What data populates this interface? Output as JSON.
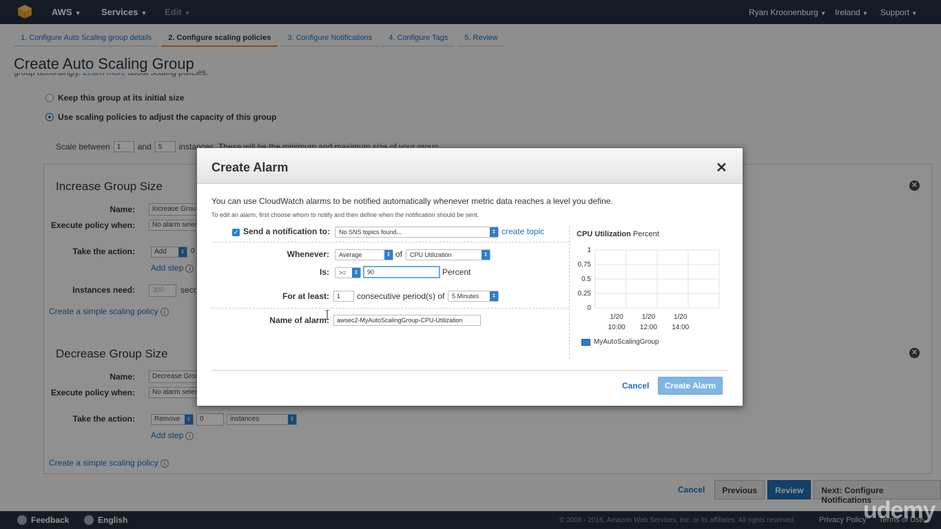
{
  "topbar": {
    "brand": "AWS",
    "services": "Services",
    "edit": "Edit",
    "user": "Ryan Kroonenburg",
    "region": "Ireland",
    "support": "Support"
  },
  "wizard_steps": [
    "1. Configure Auto Scaling group details",
    "2. Configure scaling policies",
    "3. Configure Notifications",
    "4. Configure Tags",
    "5. Review"
  ],
  "page": {
    "title": "Create Auto Scaling Group",
    "sub_prefix": "group accordingly.",
    "sub_link": "Learn more",
    "sub_suffix": "about scaling policies.",
    "option_keep": "Keep this group at its initial size",
    "option_use": "Use scaling policies to adjust the capacity of this group",
    "scale_prefix": "Scale between",
    "scale_min": "1",
    "scale_and": "and",
    "scale_max": "5",
    "scale_suffix": "instances. These will be the minimum and maximum size of your group."
  },
  "increase": {
    "title": "Increase Group Size",
    "name_label": "Name:",
    "name_value": "Increase Group",
    "execute_label": "Execute policy when:",
    "execute_value": "No alarm selec",
    "action_label": "Take the action:",
    "action_value": "Add",
    "action_num": "0",
    "add_step": "Add step",
    "instances_label": "Instances need:",
    "instances_placeholder": "300",
    "instances_unit": "seco",
    "simple_link": "Create a simple scaling policy"
  },
  "decrease": {
    "title": "Decrease Group Size",
    "name_label": "Name:",
    "name_value": "Decrease Grou",
    "execute_label": "Execute policy when:",
    "execute_value": "No alarm selec",
    "action_label": "Take the action:",
    "action_value": "Remove",
    "action_num": "0",
    "action_unit": "instances",
    "add_step": "Add step",
    "simple_link": "Create a simple scaling policy"
  },
  "bottom_buttons": {
    "cancel": "Cancel",
    "previous": "Previous",
    "review": "Review",
    "next": "Next: Configure Notifications"
  },
  "footer": {
    "feedback": "Feedback",
    "language": "English",
    "copyright": "© 2008 - 2016, Amazon Web Services, Inc. or its affiliates. All rights reserved.",
    "privacy": "Privacy Policy",
    "terms": "Terms of Use"
  },
  "modal": {
    "title": "Create Alarm",
    "close": "✕",
    "intro": "You can use CloudWatch alarms to be notified automatically whenever metric data reaches a level you define.",
    "hint": "To edit an alarm, first choose whom to notify and then define when the notification should be sent.",
    "notify_label": "Send a notification to:",
    "notify_value": "No SNS topics found...",
    "create_topic": "create topic",
    "whenever_label": "Whenever:",
    "stat_value": "Average",
    "of": "of",
    "metric_value": "CPU Utilization",
    "is_label": "Is:",
    "operator_value": ">=",
    "threshold_value": "90",
    "threshold_unit": "Percent",
    "atleast_label": "For at least:",
    "periods_value": "1",
    "periods_text": "consecutive period(s) of",
    "period_value": "5 Minutes",
    "alarm_name_label": "Name of alarm:",
    "alarm_name_value": "awsec2-MyAutoScalingGroup-CPU-Utilization",
    "cancel": "Cancel",
    "create": "Create Alarm"
  },
  "chart_data": {
    "type": "line",
    "title": "CPU Utilization",
    "ylabel": "Percent",
    "xlabel": "",
    "ylim": [
      0,
      1
    ],
    "y_ticks": [
      "1",
      "0.75",
      "0.5",
      "0.25",
      "0"
    ],
    "x_ticks": [
      {
        "date": "1/20",
        "time": "10:00"
      },
      {
        "date": "1/20",
        "time": "12:00"
      },
      {
        "date": "1/20",
        "time": "14:00"
      }
    ],
    "series": [
      {
        "name": "MyAutoScalingGroup",
        "values": []
      }
    ],
    "grid": true,
    "legend": "bottom-left",
    "series_color": "#2a7fd1"
  },
  "watermark": "udemy"
}
